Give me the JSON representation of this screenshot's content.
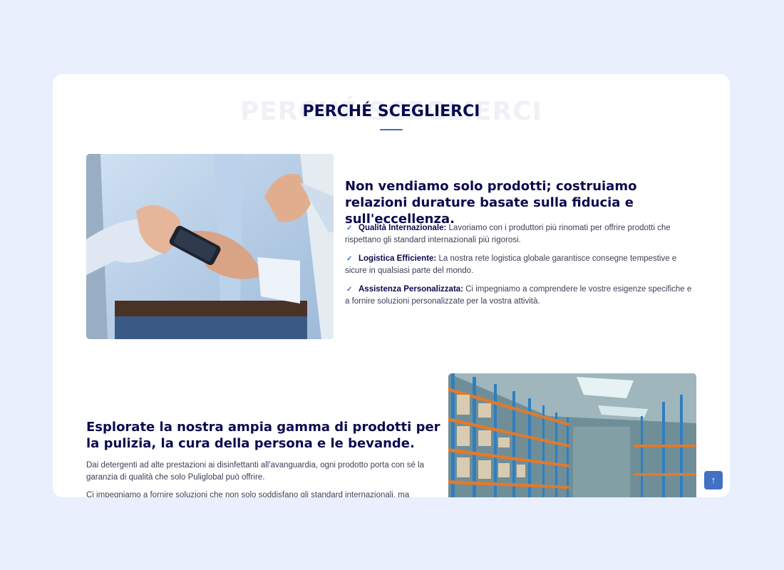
{
  "section": {
    "background_word": "PERCHÉ SCEGLIERCI",
    "title": "PERCHÉ SCEGLIERCI"
  },
  "block1": {
    "heading": "Non vendiamo solo prodotti; costruiamo relazioni durature basate sulla fiducia e sull'eccellenza.",
    "features": [
      {
        "label": "Qualità Internazionale:",
        "text": " Lavoriamo con i produttori più rinomati per offrire prodotti che rispettano gli standard internazionali più rigorosi."
      },
      {
        "label": "Logistica Efficiente:",
        "text": " La nostra rete logistica globale garantisce consegne tempestive e sicure in qualsiasi parte del mondo."
      },
      {
        "label": "Assistenza Personalizzata:",
        "text": " Ci impegniamo a comprendere le vostre esigenze specifiche e a fornire soluzioni personalizzate per la vostra attività."
      }
    ]
  },
  "block2": {
    "heading": "Esplorate la nostra ampia gamma di prodotti per la pulizia, la cura della persona e le bevande.",
    "paragraph1": "Dai detergenti ad alte prestazioni ai disinfettanti all'avanguardia, ogni prodotto porta con sé la garanzia di qualità che solo Puliglobal può offrire.",
    "paragraph2": "Ci impegniamo a fornire soluzioni che non solo soddisfano gli standard internazionali, ma"
  },
  "icons": {
    "check": "check-icon",
    "scroll_top": "arrow-up-icon"
  },
  "colors": {
    "page_background": "#e9effd",
    "heading": "#0c0a4f",
    "accent": "#4270c4"
  }
}
